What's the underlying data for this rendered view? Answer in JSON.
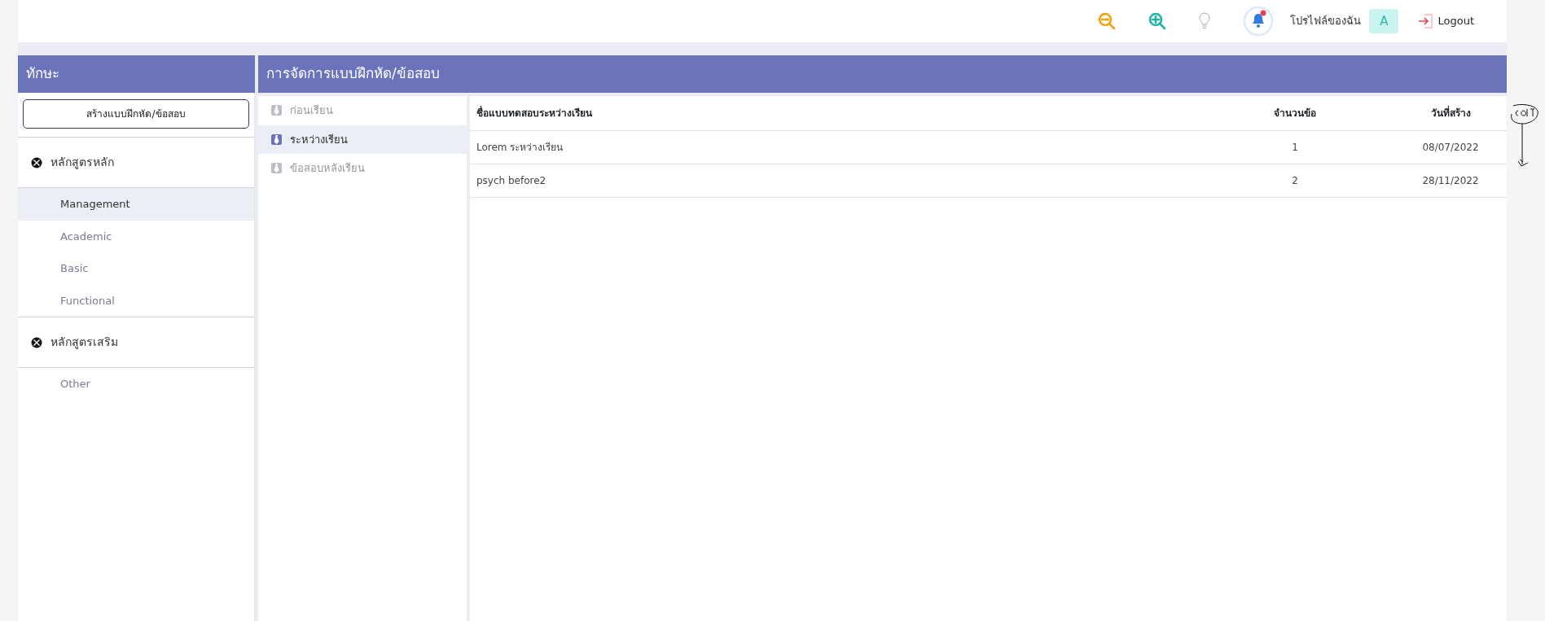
{
  "topbar": {
    "profile_label": "โปรไฟล์ของฉัน",
    "avatar": "A",
    "logout": "Logout"
  },
  "sidebar": {
    "title": "ทักษะ",
    "create_button": "สร้างแบบฝึกหัด/ข้อสอบ",
    "groups": [
      {
        "label": "หลักสูตรหลัก",
        "children": [
          {
            "label": "Management",
            "selected": true
          },
          {
            "label": "Academic",
            "selected": false
          },
          {
            "label": "Basic",
            "selected": false
          },
          {
            "label": "Functional",
            "selected": false
          }
        ]
      },
      {
        "label": "หลักสูตรเสริม",
        "children": [
          {
            "label": "Other",
            "selected": false
          }
        ]
      }
    ]
  },
  "main": {
    "title": "การจัดการแบบฝึกหัด/ข้อสอบ",
    "categories": [
      {
        "label": "ก่อนเรียน",
        "selected": false
      },
      {
        "label": "ระหว่างเรียน",
        "selected": true
      },
      {
        "label": "ข้อสอบหลังเรียน",
        "selected": false
      }
    ],
    "table": {
      "columns": [
        "ชื่อแบบทดสอบระหว่างเรียน",
        "จำนวนข้อ",
        "วันที่สร้าง"
      ],
      "rows": [
        [
          "Lorem ระหว่างเรียน",
          "1",
          "08/07/2022"
        ],
        [
          "psych before2",
          "2",
          "28/11/2022"
        ]
      ]
    }
  }
}
